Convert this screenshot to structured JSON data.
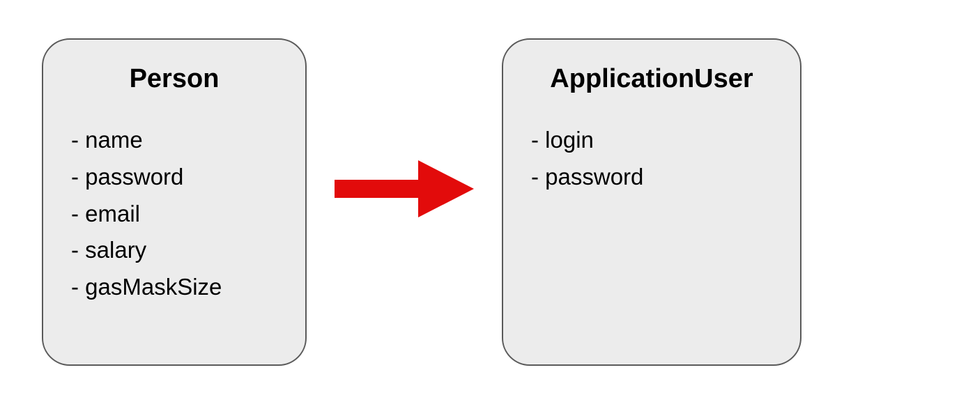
{
  "diagram": {
    "left": {
      "title": "Person",
      "attributes": [
        "- name",
        "- password",
        "- email",
        "- salary",
        "- gasMaskSize"
      ]
    },
    "right": {
      "title": "ApplicationUser",
      "attributes": [
        "- login",
        "- password"
      ]
    },
    "arrow_color": "#e20b0b"
  }
}
